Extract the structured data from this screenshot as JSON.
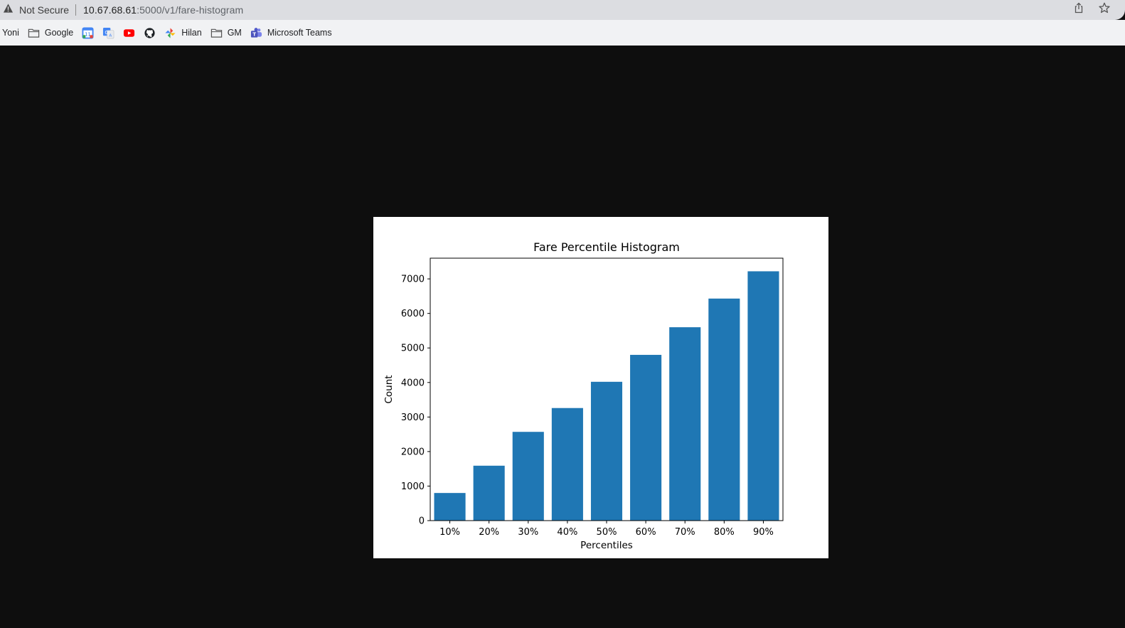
{
  "browser": {
    "security_label": "Not Secure",
    "url_host": "10.67.68.61",
    "url_path": ":5000/v1/fare-histogram"
  },
  "bookmarks": [
    {
      "label": "Yoni",
      "icon": "none"
    },
    {
      "label": "Google",
      "icon": "folder-icon"
    },
    {
      "label": "",
      "icon": "google-calendar-icon"
    },
    {
      "label": "",
      "icon": "google-translate-icon"
    },
    {
      "label": "",
      "icon": "youtube-icon"
    },
    {
      "label": "",
      "icon": "github-icon"
    },
    {
      "label": "Hilan",
      "icon": "hilan-icon"
    },
    {
      "label": "GM",
      "icon": "folder-icon"
    },
    {
      "label": "Microsoft Teams",
      "icon": "teams-icon"
    }
  ],
  "chart_data": {
    "type": "bar",
    "title": "Fare Percentile Histogram",
    "xlabel": "Percentiles",
    "ylabel": "Count",
    "categories": [
      "10%",
      "20%",
      "30%",
      "40%",
      "50%",
      "60%",
      "70%",
      "80%",
      "90%"
    ],
    "values": [
      800,
      1590,
      2570,
      3260,
      4020,
      4800,
      5600,
      6430,
      7220
    ],
    "ylim": [
      0,
      7600
    ],
    "yticks": [
      0,
      1000,
      2000,
      3000,
      4000,
      5000,
      6000,
      7000
    ],
    "bar_color": "#1f77b4",
    "grid": false
  }
}
